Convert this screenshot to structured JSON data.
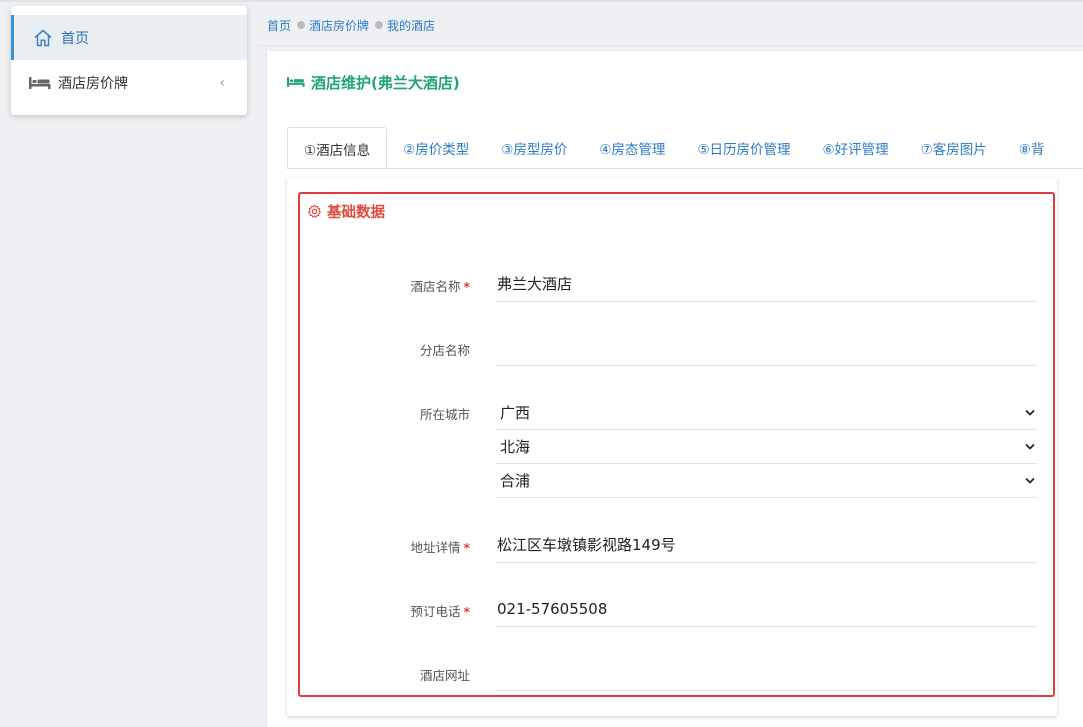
{
  "sidebar": {
    "items": [
      {
        "label": "首页",
        "icon": "home-icon"
      },
      {
        "label": "酒店房价牌",
        "icon": "bed-icon",
        "arrow": "‹"
      }
    ]
  },
  "breadcrumb": [
    "首页",
    "酒店房价牌",
    "我的酒店"
  ],
  "panel": {
    "title": "酒店维护(弗兰大酒店)",
    "tabs": [
      "①酒店信息",
      "②房价类型",
      "③房型房价",
      "④房态管理",
      "⑤日历房价管理",
      "⑥好评管理",
      "⑦客房图片",
      "⑧背"
    ],
    "active_tab": 0
  },
  "form": {
    "section_title": "基础数据",
    "hotel_name": {
      "label": "酒店名称",
      "value": "弗兰大酒店",
      "required": "*"
    },
    "branch_name": {
      "label": "分店名称",
      "value": ""
    },
    "city": {
      "label": "所在城市",
      "province": "广西",
      "city": "北海",
      "district": "合浦"
    },
    "address": {
      "label": "地址详情",
      "value": "松江区车墩镇影视路149号",
      "required": "*"
    },
    "phone": {
      "label": "预订电话",
      "value": "021-57605508",
      "required": "*"
    },
    "website": {
      "label": "酒店网址",
      "value": ""
    }
  },
  "colors": {
    "link": "#2c7bc8",
    "title_green": "#1fa37c",
    "section_red": "#e04a3f",
    "highlight_border": "#e23b3b",
    "active_nav": "#3a8fd8"
  }
}
